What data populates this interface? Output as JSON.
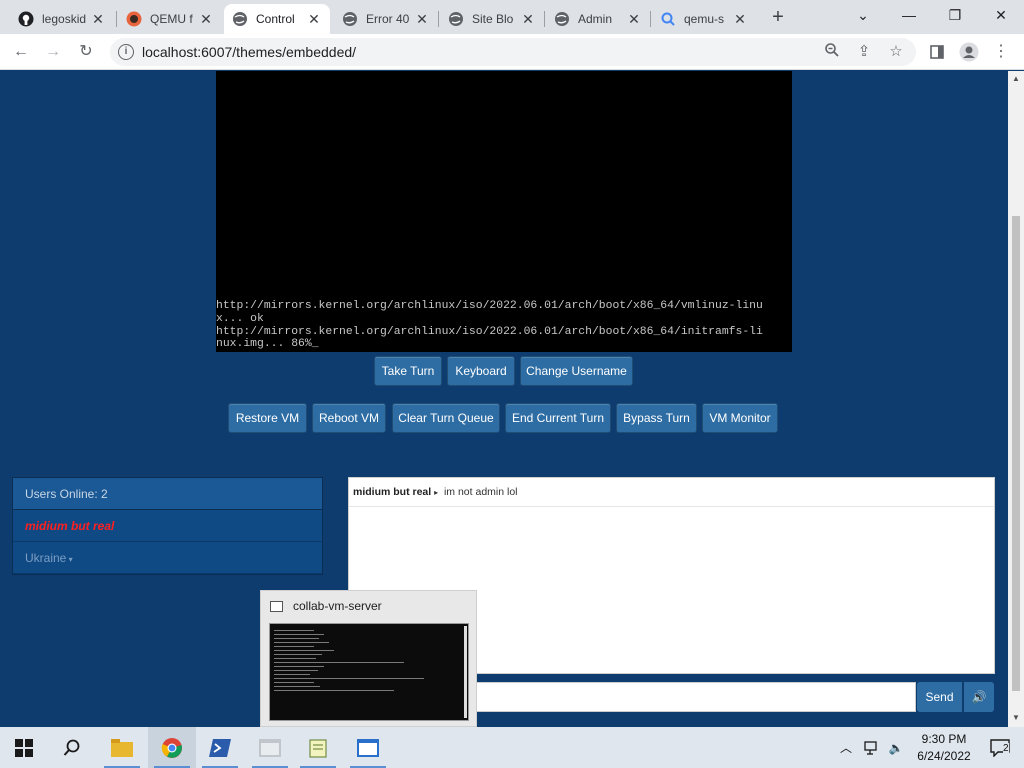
{
  "browser": {
    "tabs": [
      {
        "title": "legoskid",
        "icon": "github-icon"
      },
      {
        "title": "QEMU f",
        "icon": "qemu-icon"
      },
      {
        "title": "Control",
        "icon": "globe-icon",
        "active": true
      },
      {
        "title": "Error 40",
        "icon": "globe-icon"
      },
      {
        "title": "Site Blo",
        "icon": "globe-icon"
      },
      {
        "title": "Admin",
        "icon": "globe-icon"
      },
      {
        "title": "qemu-s",
        "icon": "search-icon"
      }
    ],
    "url": "localhost:6007/themes/embedded/"
  },
  "vm": {
    "console_text": "http://mirrors.kernel.org/archlinux/iso/2022.06.01/arch/boot/x86_64/vmlinuz-linu\nx... ok\nhttp://mirrors.kernel.org/archlinux/iso/2022.06.01/arch/boot/x86_64/initramfs-li\nnux.img... 86%_"
  },
  "controls": {
    "take_turn": "Take Turn",
    "keyboard": "Keyboard",
    "change_username": "Change Username",
    "restore_vm": "Restore VM",
    "reboot_vm": "Reboot VM",
    "clear_turn_queue": "Clear Turn Queue",
    "end_current_turn": "End Current Turn",
    "bypass_turn": "Bypass Turn",
    "vm_monitor": "VM Monitor"
  },
  "users": {
    "header": "Users Online: 2",
    "list": [
      "midium but real",
      "Ukraine"
    ]
  },
  "chat": {
    "messages": [
      {
        "user": "midium but real",
        "separator": "▸",
        "text": "im not admin lol"
      }
    ],
    "send_label": "Send"
  },
  "thumbnail": {
    "title": "collab-vm-server"
  },
  "taskbar": {
    "time": "9:30 PM",
    "date": "6/24/2022",
    "notification_count": "2"
  },
  "colors": {
    "page_bg": "#0f3c6e",
    "button_bg": "#2e6da4",
    "user_highlight": "#ff2020"
  }
}
